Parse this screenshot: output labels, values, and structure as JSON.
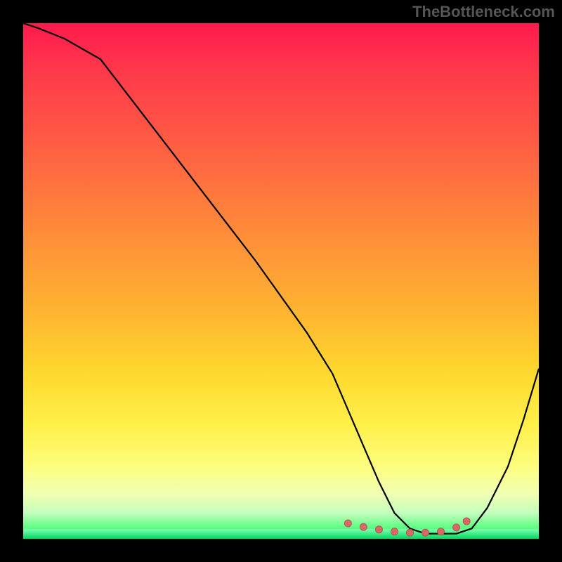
{
  "watermark": "TheBottleneck.com",
  "chart_data": {
    "type": "line",
    "title": "",
    "xlabel": "",
    "ylabel": "",
    "xlim": [
      0,
      100
    ],
    "ylim": [
      0,
      100
    ],
    "series": [
      {
        "name": "curve",
        "x": [
          0,
          3,
          8,
          15,
          25,
          35,
          45,
          55,
          60,
          63,
          66,
          69,
          72,
          75,
          78,
          81,
          84,
          87,
          90,
          94,
          97,
          100
        ],
        "values": [
          100,
          99,
          97,
          93,
          80,
          67,
          54,
          40,
          32,
          25,
          18,
          11,
          5,
          2,
          1,
          1,
          1,
          2,
          6,
          14,
          23,
          33
        ]
      }
    ],
    "markers": {
      "name": "min-region",
      "x": [
        63,
        66,
        69,
        72,
        75,
        78,
        81,
        84,
        86
      ],
      "values": [
        3,
        2.3,
        1.8,
        1.4,
        1.2,
        1.2,
        1.4,
        2.2,
        3.4
      ]
    },
    "annotations": []
  }
}
